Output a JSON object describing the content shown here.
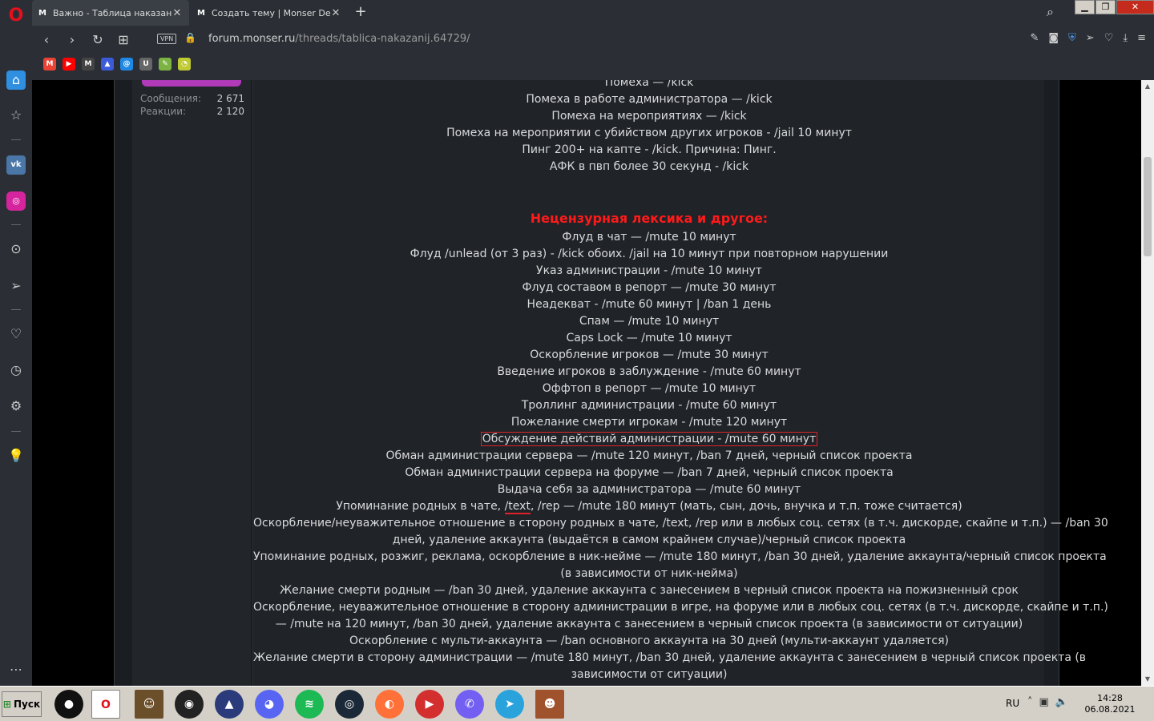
{
  "browser": {
    "logo": "O",
    "tabs": [
      {
        "favicon": "M",
        "title": "Важно - Таблица наказаний",
        "close": "✕"
      },
      {
        "favicon": "M",
        "title": "Создать тему | Monser Death",
        "close": "✕"
      }
    ],
    "add_tab": "+",
    "url_host": "forum.monser.ru",
    "url_path": "/threads/tablica-nakazanij.64729/",
    "vpn_label": "VPN",
    "window_controls": {
      "minimize": "▁",
      "restore": "❐",
      "close": "✕"
    }
  },
  "bookmarks": [
    {
      "name": "gmail",
      "glyph": "M",
      "color": "#ea4335"
    },
    {
      "name": "youtube",
      "glyph": "▶",
      "color": "#ff0000"
    },
    {
      "name": "monser",
      "glyph": "M",
      "color": "#444444"
    },
    {
      "name": "arcgis",
      "glyph": "▲",
      "color": "#3b5bdb"
    },
    {
      "name": "email",
      "glyph": "@",
      "color": "#1e88e5"
    },
    {
      "name": "ur",
      "glyph": "U",
      "color": "#666666"
    },
    {
      "name": "leaf",
      "glyph": "✎",
      "color": "#7cb342"
    },
    {
      "name": "pie",
      "glyph": "◔",
      "color": "#c0ca33"
    }
  ],
  "user_stats": [
    {
      "label": "Сообщения:",
      "value": "2 671"
    },
    {
      "label": "Реакции:",
      "value": "2 120"
    }
  ],
  "post": {
    "lines_top": [
      "Помеха — /kick",
      "Помеха в работе администратора — /kick",
      "Помеха на мероприятиях — /kick",
      "Помеха на мероприятии с убийством других игроков - /jail 10 минут",
      "Пинг 200+ на капте - /kick. Причина: Пинг.",
      "АФК в пвп более 30 секунд - /kick"
    ],
    "heading": "Нецензурная лексика и другое:",
    "lines_mid": [
      "Флуд в чат — /mute 10 минут",
      "Флуд /unlead (от 3 раз) - /kick обоих. /jail на 10 минут при повторном нарушении",
      "Указ администрации - /mute 10 минут",
      "Флуд составом в репорт — /mute 30 минут",
      "Неадекват - /mute 60 минут | /ban 1 день",
      "Спам — /mute 10 минут",
      "Caps Lock — /mute 10 минут",
      "Оскорбление игроков — /mute 30 минут",
      "Введение игроков в заблуждение - /mute 60 минут",
      "Оффтоп в репорт — /mute 10 минут",
      "Троллинг администрации - /mute 60 минут",
      "Пожелание смерти игрокам - /mute 120 минут"
    ],
    "highlighted_line": "Обсуждение действий администрации - /mute 60 минут",
    "lines_after": [
      "Обман администрации сервера — /mute 120 минут, /ban 7 дней, черный список проекта",
      "Обман администрации сервера на форуме — /ban 7 дней, черный список проекта",
      "Выдача себя за администратора — /mute 60 минут"
    ],
    "mention_line": {
      "pre": "Упоминание родных в чате, ",
      "squiggle": "/text",
      "post": ", /rep — /mute 180 минут (мать, сын, дочь, внучка и т.п. тоже считается)"
    },
    "lines_bottom": [
      "Оскорбление/неуважительное отношение в сторону родных в чате, /text, /rep или в любых соц. сетях (в т.ч. дискорде, скайпе и т.п.) — /ban 30",
      "дней, удаление аккаунта (выдаётся в самом крайнем случае)/черный список проекта",
      "Упоминание родных, розжиг, реклама, оскорбление в ник-нейме — /mute 180 минут, /ban 30 дней, удаление аккаунта/черный список проекта",
      "(в зависимости от ник-нейма)",
      "Желание смерти родным — /ban 30 дней, удаление аккаунта с занесением в черный список проекта на пожизненный срок",
      "Оскорбление, неуважительное отношение в сторону администрации в игре, на форуме или в любых соц. сетях (в т.ч. дискорде, скайпе и т.п.)",
      "— /mute на 120 минут, /ban 30 дней, удаление аккаунта с занесением в черный список проекта (в зависимости от ситуации)",
      "Оскорбление с мульти-аккаунта — /ban основного аккаунта на 30 дней (мульти-аккаунт удаляется)",
      "Желание смерти в сторону администрации — /mute 180 минут, /ban 30 дней, удаление аккаунта с занесением в черный список проекта (в",
      "зависимости от ситуации)"
    ]
  },
  "taskbar": {
    "start_label": "Пуск",
    "apps": [
      {
        "name": "recorder",
        "glyph": "●",
        "color": "#111111"
      },
      {
        "name": "opera",
        "glyph": "O",
        "color": "#e3101e"
      },
      {
        "name": "avatar-app",
        "glyph": "☺",
        "color": "#6b4f2a"
      },
      {
        "name": "obs",
        "glyph": "◉",
        "color": "#222222"
      },
      {
        "name": "arma",
        "glyph": "▲",
        "color": "#2b3a7a"
      },
      {
        "name": "discord",
        "glyph": "◕",
        "color": "#5865f2"
      },
      {
        "name": "spotify",
        "glyph": "≋",
        "color": "#1db954"
      },
      {
        "name": "steam",
        "glyph": "◎",
        "color": "#1b2838"
      },
      {
        "name": "firefox",
        "glyph": "◐",
        "color": "#ff7139"
      },
      {
        "name": "media-player",
        "glyph": "▶",
        "color": "#d32f2f"
      },
      {
        "name": "viber",
        "glyph": "✆",
        "color": "#7360f2"
      },
      {
        "name": "telegram",
        "glyph": "➤",
        "color": "#2aa3dc"
      },
      {
        "name": "game-avatar",
        "glyph": "☻",
        "color": "#a0522d"
      }
    ],
    "lang": "RU",
    "time": "14:28",
    "date": "06.08.2021"
  }
}
